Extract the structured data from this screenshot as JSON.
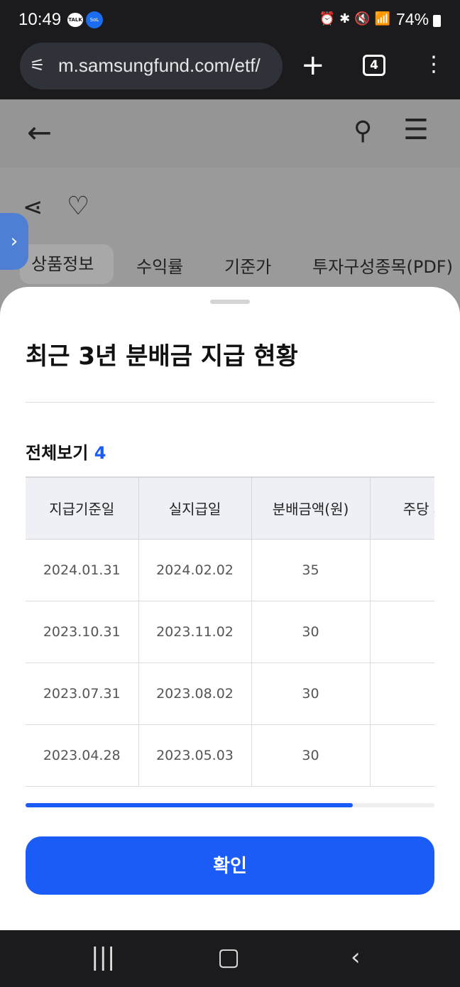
{
  "status_bar": {
    "time": "10:49",
    "talk_badge": "TALK",
    "sol_badge": "SoL",
    "battery": "74%"
  },
  "browser": {
    "url": "m.samsungfund.com/etf/",
    "tab_count": "4"
  },
  "page": {
    "tabs": [
      "상품정보",
      "수익률",
      "기준가",
      "투자구성종목(PDF)"
    ]
  },
  "sheet": {
    "title": "최근 3년 분배금 지급 현황",
    "count_label": "전체보기",
    "count_value": "4",
    "columns": [
      "지급기준일",
      "실지급일",
      "분배금액(원)",
      "주당 과"
    ],
    "rows": [
      [
        "2024.01.31",
        "2024.02.02",
        "35",
        ""
      ],
      [
        "2023.10.31",
        "2023.11.02",
        "30",
        ""
      ],
      [
        "2023.07.31",
        "2023.08.02",
        "30",
        ""
      ],
      [
        "2023.04.28",
        "2023.05.03",
        "30",
        ""
      ]
    ],
    "scroll_progress": 0.8,
    "confirm_label": "확인"
  },
  "colors": {
    "accent": "#1a5cf5",
    "header_bg": "#eef0f5"
  }
}
